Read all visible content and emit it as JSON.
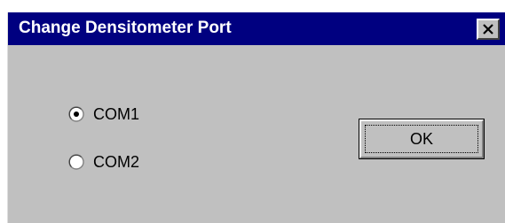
{
  "window": {
    "title": "Change Densitometer Port",
    "close_icon": "close-icon",
    "titlebar_color": "#000080",
    "body_color": "#c0c0c0"
  },
  "ports": {
    "options": [
      {
        "label": "COM1",
        "selected": true
      },
      {
        "label": "COM2",
        "selected": false
      }
    ]
  },
  "buttons": {
    "ok_label": "OK"
  }
}
